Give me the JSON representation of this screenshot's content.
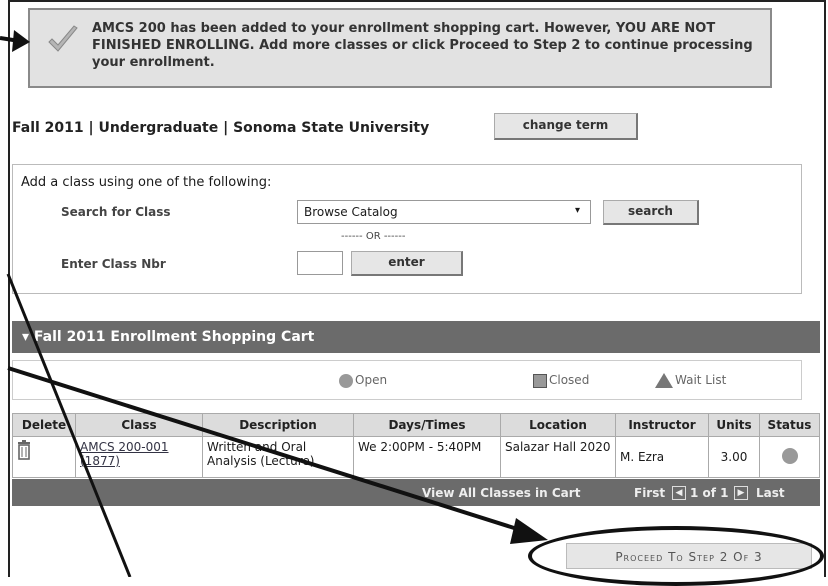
{
  "message": {
    "icon": "checkmark-icon",
    "text": "AMCS  200 has been added to your enrollment shopping cart.  However, YOU ARE NOT FINISHED ENROLLING.  Add more classes or click Proceed to Step 2 to continue processing your enrollment."
  },
  "term": {
    "title": "Fall 2011 | Undergraduate | Sonoma State University",
    "change_label": "change term"
  },
  "add_class": {
    "title": "Add a class using one of the following:",
    "search_label": "Search for Class",
    "search_select_value": "Browse Catalog",
    "search_button": "search",
    "or_text": "------ OR ------",
    "nbr_label": "Enter Class Nbr",
    "enter_button": "enter"
  },
  "cart": {
    "title": "Fall 2011 Enrollment Shopping Cart",
    "legend": {
      "open": "Open",
      "closed": "Closed",
      "waitlist": "Wait List"
    },
    "columns": [
      "Delete",
      "Class",
      "Description",
      "Days/Times",
      "Location",
      "Instructor",
      "Units",
      "Status"
    ],
    "rows": [
      {
        "class": "AMCS 200-001 (1877)",
        "description": "Written and Oral Analysis (Lecture)",
        "days_times": "We 2:00PM - 5:40PM",
        "location": "Salazar Hall 2020",
        "instructor": "M. Ezra",
        "units": "3.00",
        "status": "open"
      }
    ],
    "footer": {
      "view_all": "View All Classes in Cart",
      "first": "First",
      "page": "1 of 1",
      "last": "Last"
    }
  },
  "proceed_label": "Proceed To Step 2 Of 3",
  "colors": {
    "bar": "#6b6b6b",
    "message_bg": "#e2e2e2",
    "annotation": "#111111"
  }
}
